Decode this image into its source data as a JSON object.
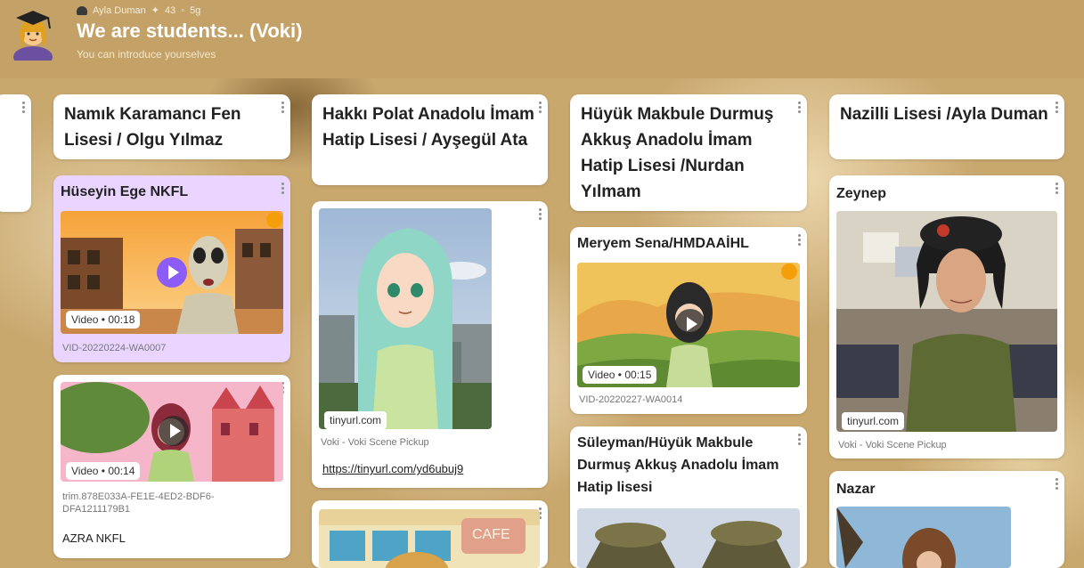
{
  "header": {
    "author": "Ayla Duman",
    "likes": "43",
    "age": "5g",
    "title": "We are students... (Voki)",
    "subtitle": "You can introduce yourselves"
  },
  "columns": [
    {
      "title": "Namık Karamancı Fen Lisesi / Olgu Yılmaz",
      "posts": [
        {
          "title": "Hüseyin Ege NKFL",
          "video": "Video • 00:18",
          "caption": "VID-20220224-WA0007"
        },
        {
          "video": "Video • 00:14",
          "caption": "trim.878E033A-FE1E-4ED2-BDF6-DFA1211179B1",
          "body": "AZRA NKFL"
        }
      ]
    },
    {
      "title": "Hakkı Polat Anadolu İmam Hatip Lisesi / Ayşegül Ata",
      "posts": [
        {
          "pill": "tinyurl.com",
          "caption": "Voki - Voki Scene Pickup",
          "link": "https://tinyurl.com/yd6ubuj9"
        },
        {
          "sign": "CAFE"
        }
      ]
    },
    {
      "title": "Hüyük Makbule Durmuş Akkuş Anadolu İmam Hatip Lisesi /Nurdan Yılmam",
      "posts": [
        {
          "title": "Meryem Sena/HMDAAİHL",
          "video": "Video • 00:15",
          "caption": "VID-20220227-WA0014"
        },
        {
          "title": "Süleyman/Hüyük Makbule Durmuş Akkuş Anadolu İmam Hatip lisesi"
        }
      ]
    },
    {
      "title": "Nazilli Lisesi /Ayla Duman",
      "posts": [
        {
          "title": "Zeynep",
          "pill": "tinyurl.com",
          "caption": "Voki - Voki Scene Pickup"
        },
        {
          "title": "Nazar"
        }
      ]
    }
  ],
  "icons": {
    "menu": "kebab-menu-icon",
    "play": "play-icon",
    "like": "star-icon",
    "time": "clock-icon"
  },
  "colors": {
    "header": "#c4a267",
    "play_purple": "#8b5cf6",
    "highlight_card": "#e9d5ff"
  }
}
